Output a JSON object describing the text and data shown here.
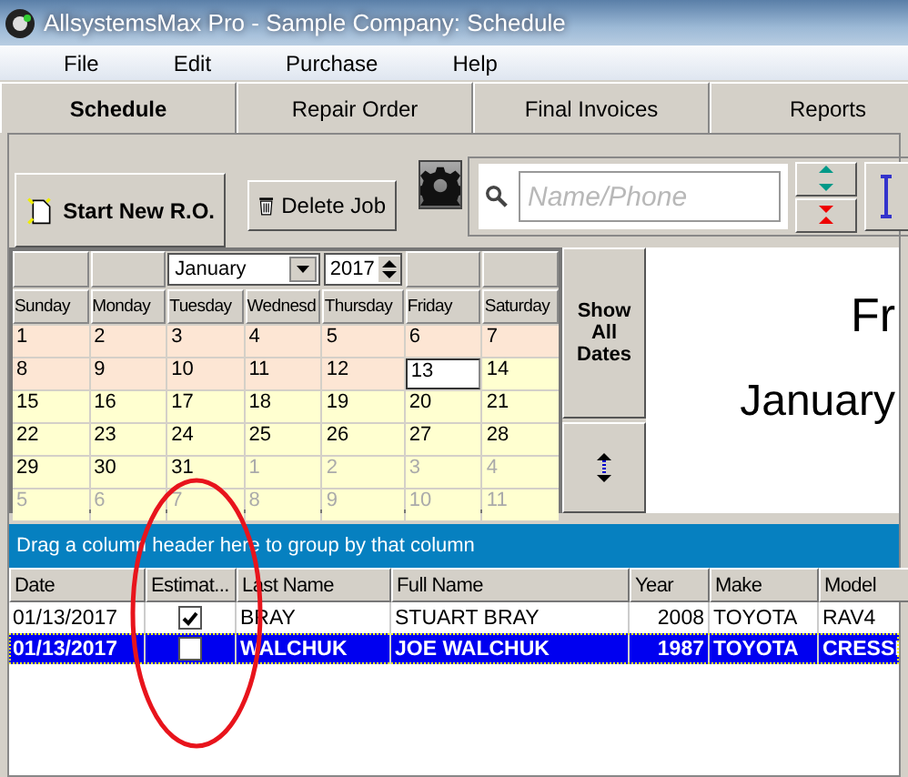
{
  "window": {
    "title": "AllsystemsMax  Pro - Sample Company: Schedule"
  },
  "menu": [
    "File",
    "Edit",
    "Purchase",
    "Help"
  ],
  "tabs": [
    {
      "label": "Schedule",
      "selected": true
    },
    {
      "label": "Repair Order",
      "selected": false
    },
    {
      "label": "Final Invoices",
      "selected": false
    },
    {
      "label": "Reports",
      "selected": false
    }
  ],
  "toolbar": {
    "start_button": "Start New R.O.",
    "delete_button": "Delete Job",
    "search": {
      "placeholder": "Name/Phone"
    }
  },
  "calendar": {
    "month": "January",
    "year": "2017",
    "weekdays": [
      "Sunday",
      "Monday",
      "Tuesday",
      "Wednesd",
      "Thursday",
      "Friday",
      "Saturday"
    ],
    "weeks": [
      [
        {
          "day": "1",
          "kind": "past",
          "selected": false
        },
        {
          "day": "2",
          "kind": "past",
          "selected": false
        },
        {
          "day": "3",
          "kind": "past",
          "selected": false
        },
        {
          "day": "4",
          "kind": "past",
          "selected": false
        },
        {
          "day": "5",
          "kind": "past",
          "selected": false
        },
        {
          "day": "6",
          "kind": "past",
          "selected": false
        },
        {
          "day": "7",
          "kind": "past",
          "selected": false
        }
      ],
      [
        {
          "day": "8",
          "kind": "past",
          "selected": false
        },
        {
          "day": "9",
          "kind": "past",
          "selected": false
        },
        {
          "day": "10",
          "kind": "past",
          "selected": false
        },
        {
          "day": "11",
          "kind": "past",
          "selected": false
        },
        {
          "day": "12",
          "kind": "past",
          "selected": false
        },
        {
          "day": "13",
          "kind": "today",
          "selected": true
        },
        {
          "day": "14",
          "kind": "future",
          "selected": false
        }
      ],
      [
        {
          "day": "15",
          "kind": "future",
          "selected": false
        },
        {
          "day": "16",
          "kind": "future",
          "selected": false
        },
        {
          "day": "17",
          "kind": "future",
          "selected": false
        },
        {
          "day": "18",
          "kind": "future",
          "selected": false
        },
        {
          "day": "19",
          "kind": "future",
          "selected": false
        },
        {
          "day": "20",
          "kind": "future",
          "selected": false
        },
        {
          "day": "21",
          "kind": "future",
          "selected": false
        }
      ],
      [
        {
          "day": "22",
          "kind": "future",
          "selected": false
        },
        {
          "day": "23",
          "kind": "future",
          "selected": false
        },
        {
          "day": "24",
          "kind": "future",
          "selected": false
        },
        {
          "day": "25",
          "kind": "future",
          "selected": false
        },
        {
          "day": "26",
          "kind": "future",
          "selected": false
        },
        {
          "day": "27",
          "kind": "future",
          "selected": false
        },
        {
          "day": "28",
          "kind": "future",
          "selected": false
        }
      ],
      [
        {
          "day": "29",
          "kind": "future",
          "selected": false
        },
        {
          "day": "30",
          "kind": "future",
          "selected": false
        },
        {
          "day": "31",
          "kind": "future",
          "selected": false
        },
        {
          "day": "1",
          "kind": "other",
          "selected": false
        },
        {
          "day": "2",
          "kind": "other",
          "selected": false
        },
        {
          "day": "3",
          "kind": "other",
          "selected": false
        },
        {
          "day": "4",
          "kind": "other",
          "selected": false
        }
      ],
      [
        {
          "day": "5",
          "kind": "other",
          "selected": false
        },
        {
          "day": "6",
          "kind": "other",
          "selected": false
        },
        {
          "day": "7",
          "kind": "other",
          "selected": false
        },
        {
          "day": "8",
          "kind": "other",
          "selected": false
        },
        {
          "day": "9",
          "kind": "other",
          "selected": false
        },
        {
          "day": "10",
          "kind": "other",
          "selected": false
        },
        {
          "day": "11",
          "kind": "other",
          "selected": false
        }
      ]
    ]
  },
  "show_all_button": "Show All Dates",
  "date_panel": {
    "weekday": "Fr",
    "date": "January"
  },
  "grid": {
    "group_hint": "Drag a column header here to group by that column",
    "columns": [
      "Date",
      "Estimat...",
      "Last Name",
      "Full Name",
      "Year",
      "Make",
      "Model"
    ],
    "rows": [
      {
        "date": "01/13/2017",
        "estimate": true,
        "last_name": "BRAY",
        "full_name": "STUART BRAY",
        "year": "2008",
        "make": "TOYOTA",
        "model": "RAV4",
        "selected": false
      },
      {
        "date": "01/13/2017",
        "estimate": false,
        "last_name": "WALCHUK",
        "full_name": "JOE WALCHUK",
        "year": "1987",
        "make": "TOYOTA",
        "model": "CRESSI",
        "selected": true
      }
    ]
  }
}
